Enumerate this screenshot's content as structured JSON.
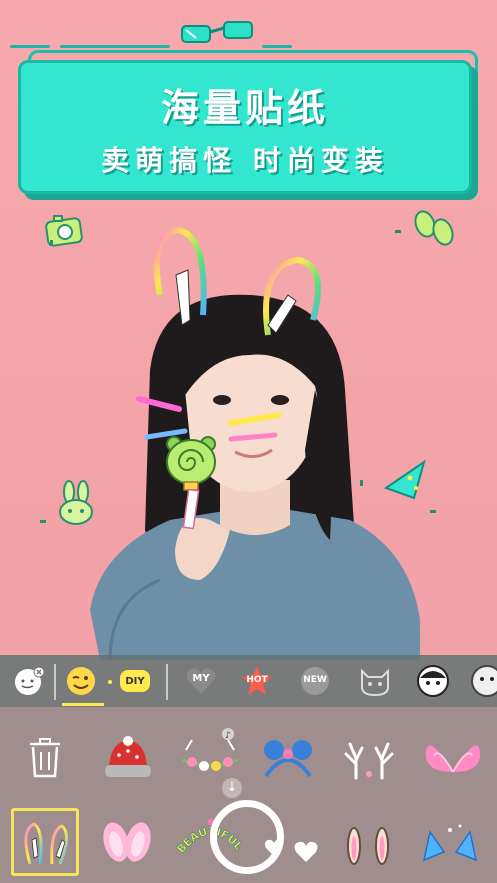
{
  "banner": {
    "title": "海量贴纸",
    "subtitle": "卖萌搞怪 时尚变装"
  },
  "categories": [
    {
      "name": "clear-sticker",
      "label": ""
    },
    {
      "name": "face-sticker",
      "label": ""
    },
    {
      "name": "diy",
      "label": "DIY"
    },
    {
      "name": "my",
      "label": "MY"
    },
    {
      "name": "hot",
      "label": "HOT"
    },
    {
      "name": "new",
      "label": "NEW"
    },
    {
      "name": "cat-face",
      "label": ""
    },
    {
      "name": "anime-face",
      "label": ""
    },
    {
      "name": "cartoon-face",
      "label": ""
    }
  ],
  "stickers_row1": [
    "trash",
    "knit-hat",
    "flower-crown",
    "mouse-ears",
    "deer-antlers",
    "butterfly-wings"
  ],
  "stickers_row2": [
    "rainbow-bunny-ears",
    "pink-bunny-ears",
    "beautiful-crown",
    "white-hearts",
    "brown-bunny-ears",
    "blue-cat-ears"
  ],
  "beautiful_text": "BEAUTIFUL",
  "colors": {
    "background": "#f4a6aa",
    "banner": "#33e6cf",
    "banner_border": "#19b7a4",
    "selection": "#f7e55b"
  }
}
